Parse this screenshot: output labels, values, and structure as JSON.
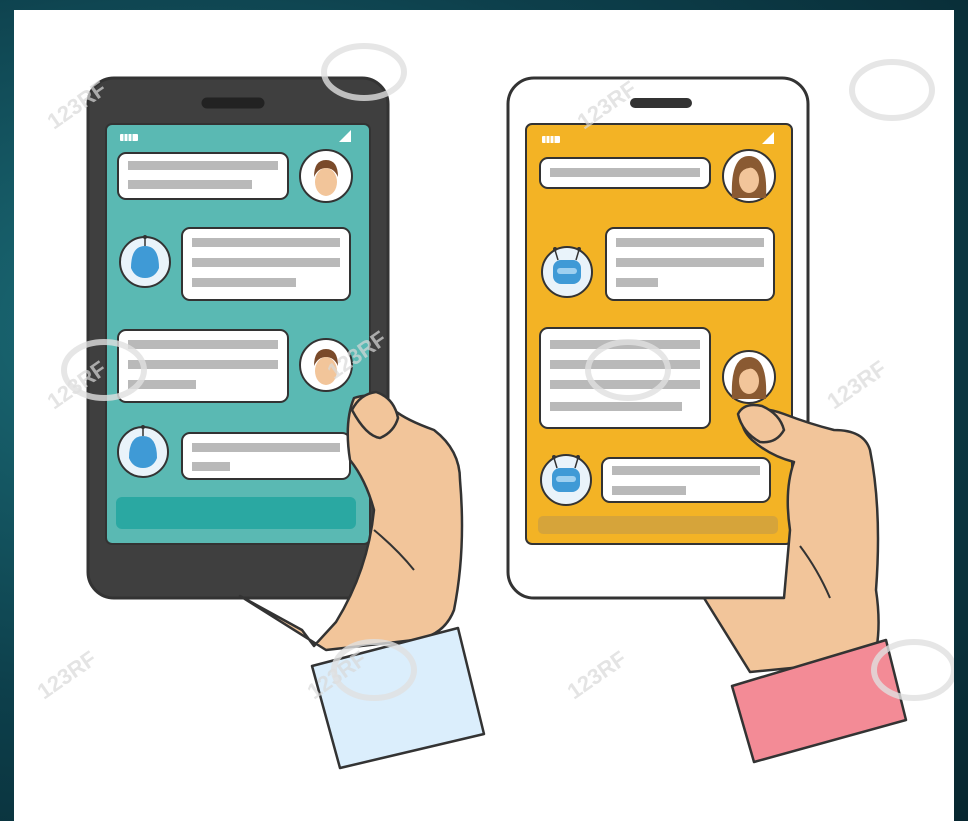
{
  "watermark": {
    "text": "123RF"
  },
  "colors": {
    "outline": "#333333",
    "dark_phone_body": "#3f3f3f",
    "light_phone_body": "#ffffff",
    "teal_screen": "#5ab9b3",
    "teal_input_bar": "#2aa8a2",
    "orange_screen": "#f3b325",
    "orange_input_bar": "#d6a43a",
    "bubble_fill": "#ffffff",
    "text_line": "#b9b9b9",
    "bot_blue": "#3f9ad6",
    "bot_bg": "#e9f3fa",
    "skin": "#f2c59a",
    "man_hair": "#7a4a2a",
    "woman_hair": "#8a5a32",
    "light_blue_cuff": "#dbeefc",
    "pink_cuff": "#f38b96"
  },
  "phones": [
    {
      "style": "dark",
      "screen_color": "teal",
      "status_icons": [
        "battery-icon",
        "signal-icon"
      ],
      "messages": [
        {
          "sender": "user-man",
          "lines": 2
        },
        {
          "sender": "bot",
          "lines": 3
        },
        {
          "sender": "user-man",
          "lines": 3
        },
        {
          "sender": "bot",
          "lines": 2
        }
      ],
      "cuff_color": "light-blue"
    },
    {
      "style": "light",
      "screen_color": "orange",
      "status_icons": [
        "battery-icon",
        "signal-icon"
      ],
      "messages": [
        {
          "sender": "user-woman",
          "lines": 1
        },
        {
          "sender": "bot",
          "lines": 3
        },
        {
          "sender": "user-woman",
          "lines": 4
        },
        {
          "sender": "bot",
          "lines": 2
        }
      ],
      "cuff_color": "pink"
    }
  ]
}
